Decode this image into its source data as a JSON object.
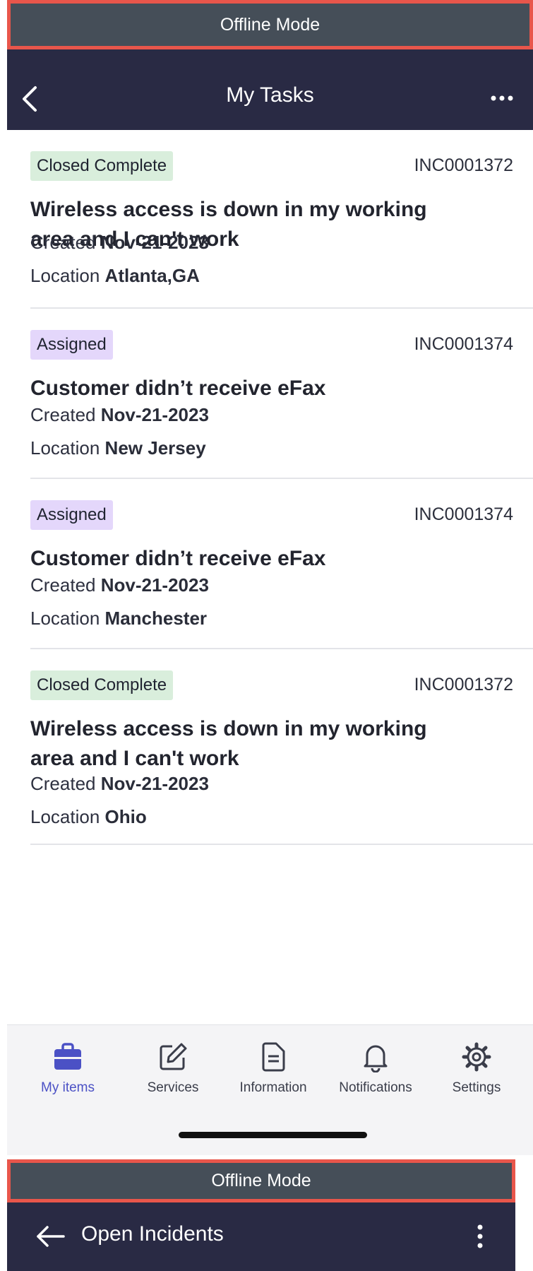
{
  "screen1": {
    "offline_banner": "Offline Mode",
    "header": {
      "title": "My Tasks"
    },
    "tasks": [
      {
        "status": "Closed Complete",
        "number": "INC0001372",
        "title": "Wireless access is down in my working area and I can't work",
        "created_label": "Created",
        "created": "Nov-21-2023",
        "location_label": "Location",
        "location": "Atlanta,GA"
      },
      {
        "status": "Assigned",
        "number": "INC0001374",
        "title": "Customer didn’t receive eFax",
        "created_label": "Created",
        "created": "Nov-21-2023",
        "location_label": "Location",
        "location": "New Jersey"
      },
      {
        "status": "Assigned",
        "number": "INC0001374",
        "title": "Customer didn’t receive eFax",
        "created_label": "Created",
        "created": "Nov-21-2023",
        "location_label": "Location",
        "location": "Manchester"
      },
      {
        "status": "Closed Complete",
        "number": "INC0001372",
        "title": "Wireless access is down in my working area and I can't work",
        "created_label": "Created",
        "created": "Nov-21-2023",
        "location_label": "Location",
        "location": "Ohio"
      }
    ],
    "tab_bar": [
      {
        "label": "My items",
        "icon": "briefcase-icon",
        "active": true
      },
      {
        "label": "Services",
        "icon": "edit-icon",
        "active": false
      },
      {
        "label": "Information",
        "icon": "document-icon",
        "active": false
      },
      {
        "label": "Notifications",
        "icon": "bell-icon",
        "active": false
      },
      {
        "label": "Settings",
        "icon": "gear-icon",
        "active": false
      }
    ]
  },
  "screen2": {
    "offline_banner": "Offline Mode",
    "header": {
      "title": "Open Incidents"
    }
  },
  "colors": {
    "header_bg": "#292a44",
    "offline_bg": "#454e58",
    "highlight_border": "#e8564b",
    "badge_closed": "#d9eedc",
    "badge_assigned": "#e4d7fb",
    "active_tab": "#4b51c5"
  }
}
